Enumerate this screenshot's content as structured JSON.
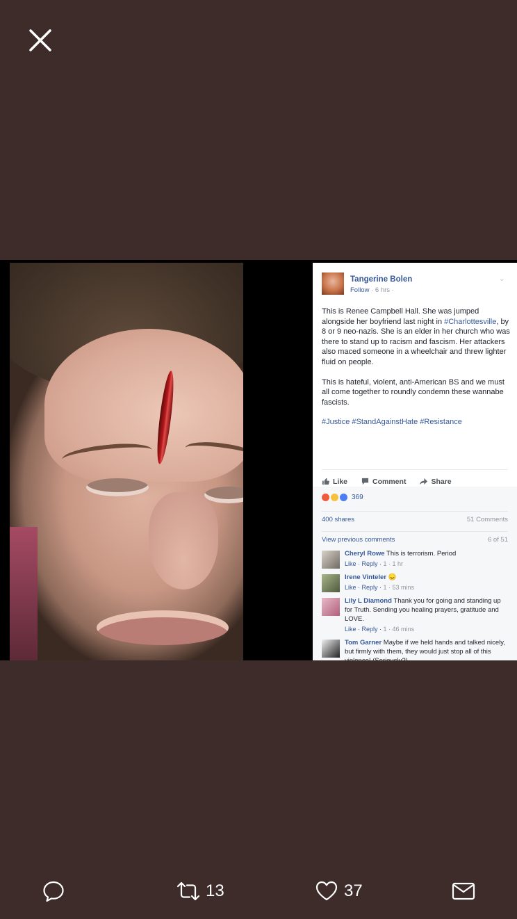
{
  "header": {
    "close_icon": "close-icon"
  },
  "post": {
    "author": "Tangerine Bolen",
    "follow": "Follow",
    "time": "· 6 hrs ·",
    "p1_a": "This is Renee Campbell Hall. She was jumped alongside her boyfriend last night in ",
    "p1_hashtag": "#Charlottesville",
    "p1_b": ", by 8 or 9 neo-nazis. She is an elder in her church who was there to stand up to racism and fascism. Her attackers also maced someone in a wheelchair and threw lighter fluid on people.",
    "p2": "This is hateful, violent, anti-American BS and we must all come together to roundly condemn these wannabe fascists.",
    "hashtags": [
      "#Justice",
      "#StandAgainstHate",
      "#Resistance"
    ],
    "actions": {
      "like": "Like",
      "comment": "Comment",
      "share": "Share"
    },
    "reaction_count": "369",
    "shares": "400 shares",
    "comments_count": "51 Comments",
    "view_previous": "View previous comments",
    "comments_page": "6 of 51",
    "comments": [
      {
        "name": "Cheryl Rowe",
        "text": "This is terrorism. Period",
        "meta_like": "Like · Reply ·",
        "meta_rest": "1 · 1 hr"
      },
      {
        "name": "Irene Vinteler",
        "text": "😞",
        "meta_like": "Like · Reply ·",
        "meta_rest": "1 · 53 mins"
      },
      {
        "name": "Lily L Diamond",
        "text": "Thank you for going and standing up for Truth. Sending you healing prayers, gratitude and LOVE.",
        "meta_like": "Like · Reply ·",
        "meta_rest": "1 · 46 mins"
      },
      {
        "name": "Tom Garner",
        "text": "Maybe if we held hands and talked nicely, but firmly with them, they would just stop all of this violence! (Seriously?)",
        "meta_like": "",
        "meta_rest": ""
      }
    ]
  },
  "toolbar": {
    "reply_icon": "reply-icon",
    "retweet_icon": "retweet-icon",
    "retweet_count": "13",
    "like_icon": "heart-icon",
    "like_count": "37",
    "dm_icon": "envelope-icon"
  },
  "colors": {
    "background": "#3e2c2b",
    "fb_link": "#365899",
    "fb_gray_text": "#90949c"
  }
}
